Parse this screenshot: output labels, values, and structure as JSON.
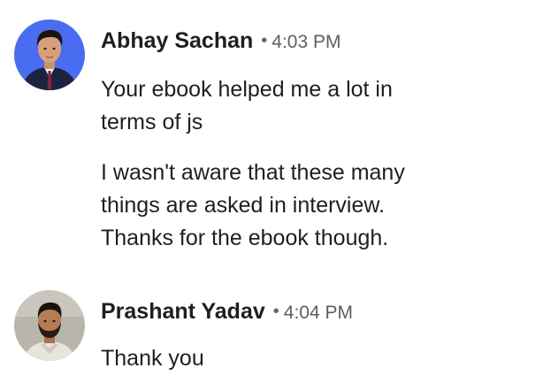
{
  "messages": [
    {
      "author": "Abhay Sachan",
      "separator": "•",
      "time": "4:03 PM",
      "paragraphs": [
        "Your ebook helped me a lot in\nterms of js",
        "I wasn't aware that these many\nthings are asked in interview.\nThanks for the ebook though."
      ],
      "avatar_icon": "profile-photo",
      "avatar_bg": "#4a6cf0"
    },
    {
      "author": "Prashant Yadav",
      "separator": "•",
      "time": "4:04 PM",
      "paragraphs": [
        "Thank you"
      ],
      "avatar_icon": "profile-photo",
      "avatar_bg": "#b8b6ab"
    }
  ]
}
